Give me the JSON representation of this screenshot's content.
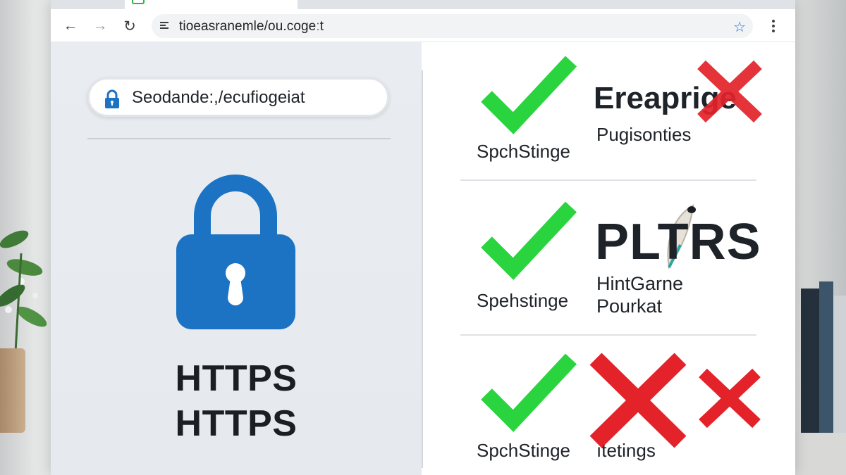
{
  "browser": {
    "url": "tioeasranemle/ou.cogeːt",
    "back_label": "←",
    "forward_label": "→",
    "reload_label": "↻",
    "bookmark_label": "☆"
  },
  "left_panel": {
    "secure_text": "Seodande:,/ecufiogeiat",
    "https_line1": "HTTPS",
    "https_line2": "HTTPS"
  },
  "rows": [
    {
      "status_label": "SpchStinge",
      "title": "Ereaprige",
      "subtitle": "Pugisonties",
      "mark": "check",
      "overlay": "cross"
    },
    {
      "status_label": "Spehstinge",
      "title": "PLTRS",
      "subtitle_line1": "HintGarne",
      "subtitle_line2": "Pourkat",
      "mark": "check"
    },
    {
      "status_label": "SpchStinge",
      "title": "ıtetings",
      "mark": "check",
      "overlay": "cross"
    }
  ],
  "colors": {
    "check_green": "#2ad43f",
    "cross_red": "#e3222a",
    "lock_blue": "#1c73c4",
    "accent_blue": "#1a73e8"
  }
}
